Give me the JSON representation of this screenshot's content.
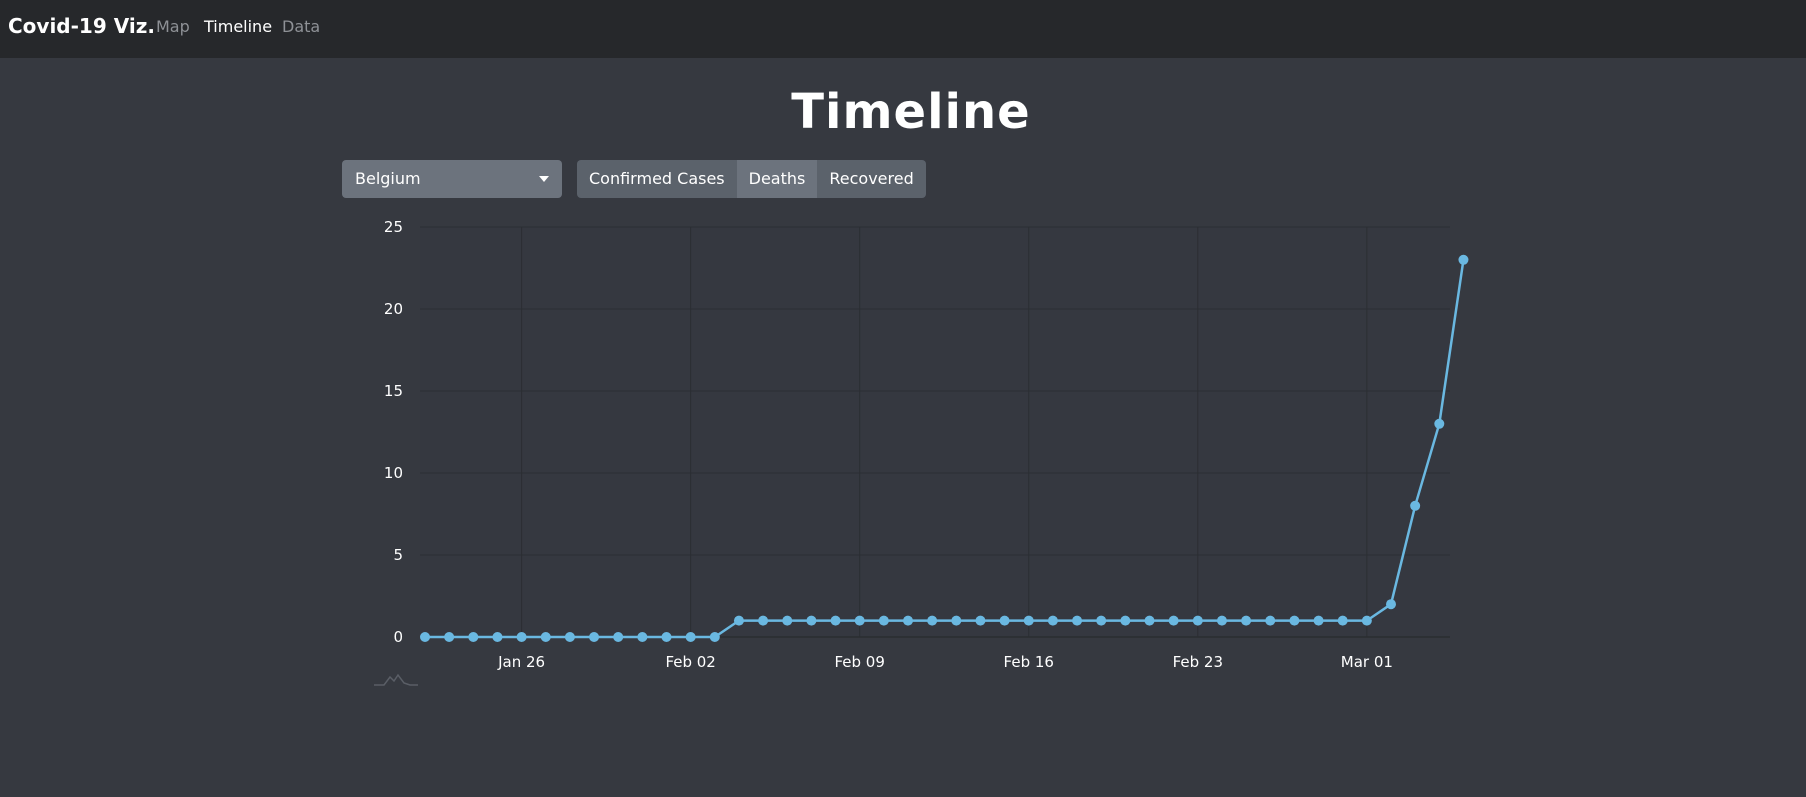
{
  "navbar": {
    "brand": "Covid-19 Viz.",
    "links": [
      {
        "label": "Map",
        "active": false
      },
      {
        "label": "Timeline",
        "active": true
      },
      {
        "label": "Data",
        "active": false
      }
    ]
  },
  "page": {
    "title": "Timeline"
  },
  "controls": {
    "country": "Belgium",
    "metrics": [
      {
        "label": "Confirmed Cases",
        "active": false
      },
      {
        "label": "Deaths",
        "active": true
      },
      {
        "label": "Recovered",
        "active": false
      }
    ]
  },
  "colors": {
    "line": "#6ab8e1",
    "background": "#363940",
    "navbar": "#26282b",
    "grid": "#2b2e33"
  },
  "chart_data": {
    "type": "line",
    "x_start": "Jan 22",
    "xtick_labels": [
      "Jan 26",
      "Feb 02",
      "Feb 09",
      "Feb 16",
      "Feb 23",
      "Mar 01"
    ],
    "ylim": [
      0,
      25
    ],
    "yticks": [
      0,
      5,
      10,
      15,
      20,
      25
    ],
    "grid": true,
    "series": [
      {
        "values": [
          0,
          0,
          0,
          0,
          0,
          0,
          0,
          0,
          0,
          0,
          0,
          0,
          0,
          1,
          1,
          1,
          1,
          1,
          1,
          1,
          1,
          1,
          1,
          1,
          1,
          1,
          1,
          1,
          1,
          1,
          1,
          1,
          1,
          1,
          1,
          1,
          1,
          1,
          1,
          1,
          2,
          8,
          13,
          23
        ]
      }
    ]
  }
}
